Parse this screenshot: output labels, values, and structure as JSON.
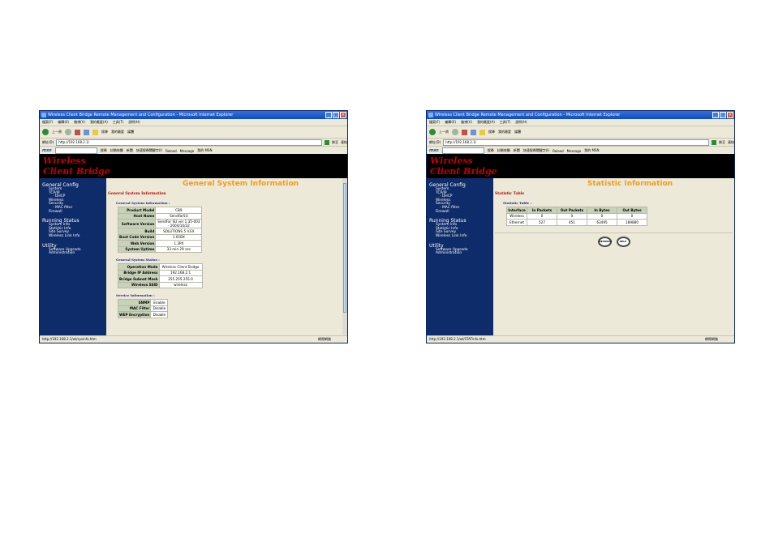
{
  "window_title": "Wireless Client Bridge Remote Management and Configuration - Microsoft Internet Explorer",
  "menu": [
    "檔案(F)",
    "編輯(E)",
    "檢視(V)",
    "我的最愛(A)",
    "工具(T)",
    "說明(H)"
  ],
  "toolbar": {
    "back": "上一頁",
    "search": "搜尋",
    "favorites": "我的最愛",
    "media": "媒體"
  },
  "address": {
    "label": "網址(D)",
    "url": "http://192.168.2.1/",
    "go": "移至",
    "links": "連結"
  },
  "links": {
    "search": "搜尋",
    "popup": "封鎖快顯",
    "news": "新聞",
    "tools": "快速搜尋關鍵字(I)",
    "reload": "Reload",
    "message": "Message",
    "mine": "我的 MSN"
  },
  "banner": {
    "line1": "Wireless",
    "line2": "Client Bridge"
  },
  "sidebar": {
    "general": {
      "title": "General Config",
      "items": [
        "System",
        "TCP/IP",
        "- DHCP",
        "Wireless",
        "Security",
        "- MAC filter",
        "Firewall"
      ]
    },
    "running": {
      "title": "Running Status",
      "items": [
        "System Info",
        "Statistic Info",
        "Site Survey",
        "Wireless Link Info"
      ]
    },
    "utility": {
      "title": "Utility",
      "items": [
        "Software Upgrade",
        "Administration"
      ]
    }
  },
  "win1": {
    "page_title": "General System Information",
    "subheading": "General System Information",
    "info": {
      "label": "General System Information :",
      "rows": [
        {
          "k": "Product Model",
          "v": "CB9"
        },
        {
          "k": "Host Name",
          "v": "SendFarSU"
        },
        {
          "k": "Software Version",
          "v": "SendFar SU ver 1.35-003 - 2004/10/22"
        },
        {
          "k": "Build",
          "v": "SOLUTIONS 5 V.EX"
        },
        {
          "k": "Boot Code Version",
          "v": "1.01BX"
        },
        {
          "k": "Web Version",
          "v": "1.3PX"
        },
        {
          "k": "System Uptime",
          "v": "33 min 29 sec"
        }
      ]
    },
    "status": {
      "label": "General System Status :",
      "rows": [
        {
          "k": "Operation Mode",
          "v": "Wireless Client Bridge"
        },
        {
          "k": "Bridge IP Address",
          "v": "192.168.2.1"
        },
        {
          "k": "Bridge Subnet Mask",
          "v": "255.255.255.0"
        },
        {
          "k": "Wireless SSID",
          "v": "wireless"
        }
      ]
    },
    "service": {
      "label": "Service Information :",
      "rows": [
        {
          "k": "SNMP",
          "v": "Enable"
        },
        {
          "k": "MAC Filter",
          "v": "Disable"
        },
        {
          "k": "WEP Encryption",
          "v": "Disable"
        }
      ]
    },
    "status_url": "http://192.168.2.1/wl/sysinfo.htm",
    "zone": "網際網路"
  },
  "win2": {
    "page_title": "Statistic Information",
    "subheading": "Statistic Table",
    "table_label": "Statistic Table :",
    "headers": [
      "Interface",
      "In Packets",
      "Out Packets",
      "In Bytes",
      "Out Bytes"
    ],
    "rows": [
      [
        "Wireless",
        "0",
        "0",
        "0",
        "0"
      ],
      [
        "Ethernet",
        "527",
        "451",
        "63495",
        "189880"
      ]
    ],
    "buttons": {
      "refresh": "REFRESH",
      "help": "HELP"
    },
    "status_url": "http://192.168.2.1/wl/STATinfo.htm",
    "zone": "網際網路"
  }
}
